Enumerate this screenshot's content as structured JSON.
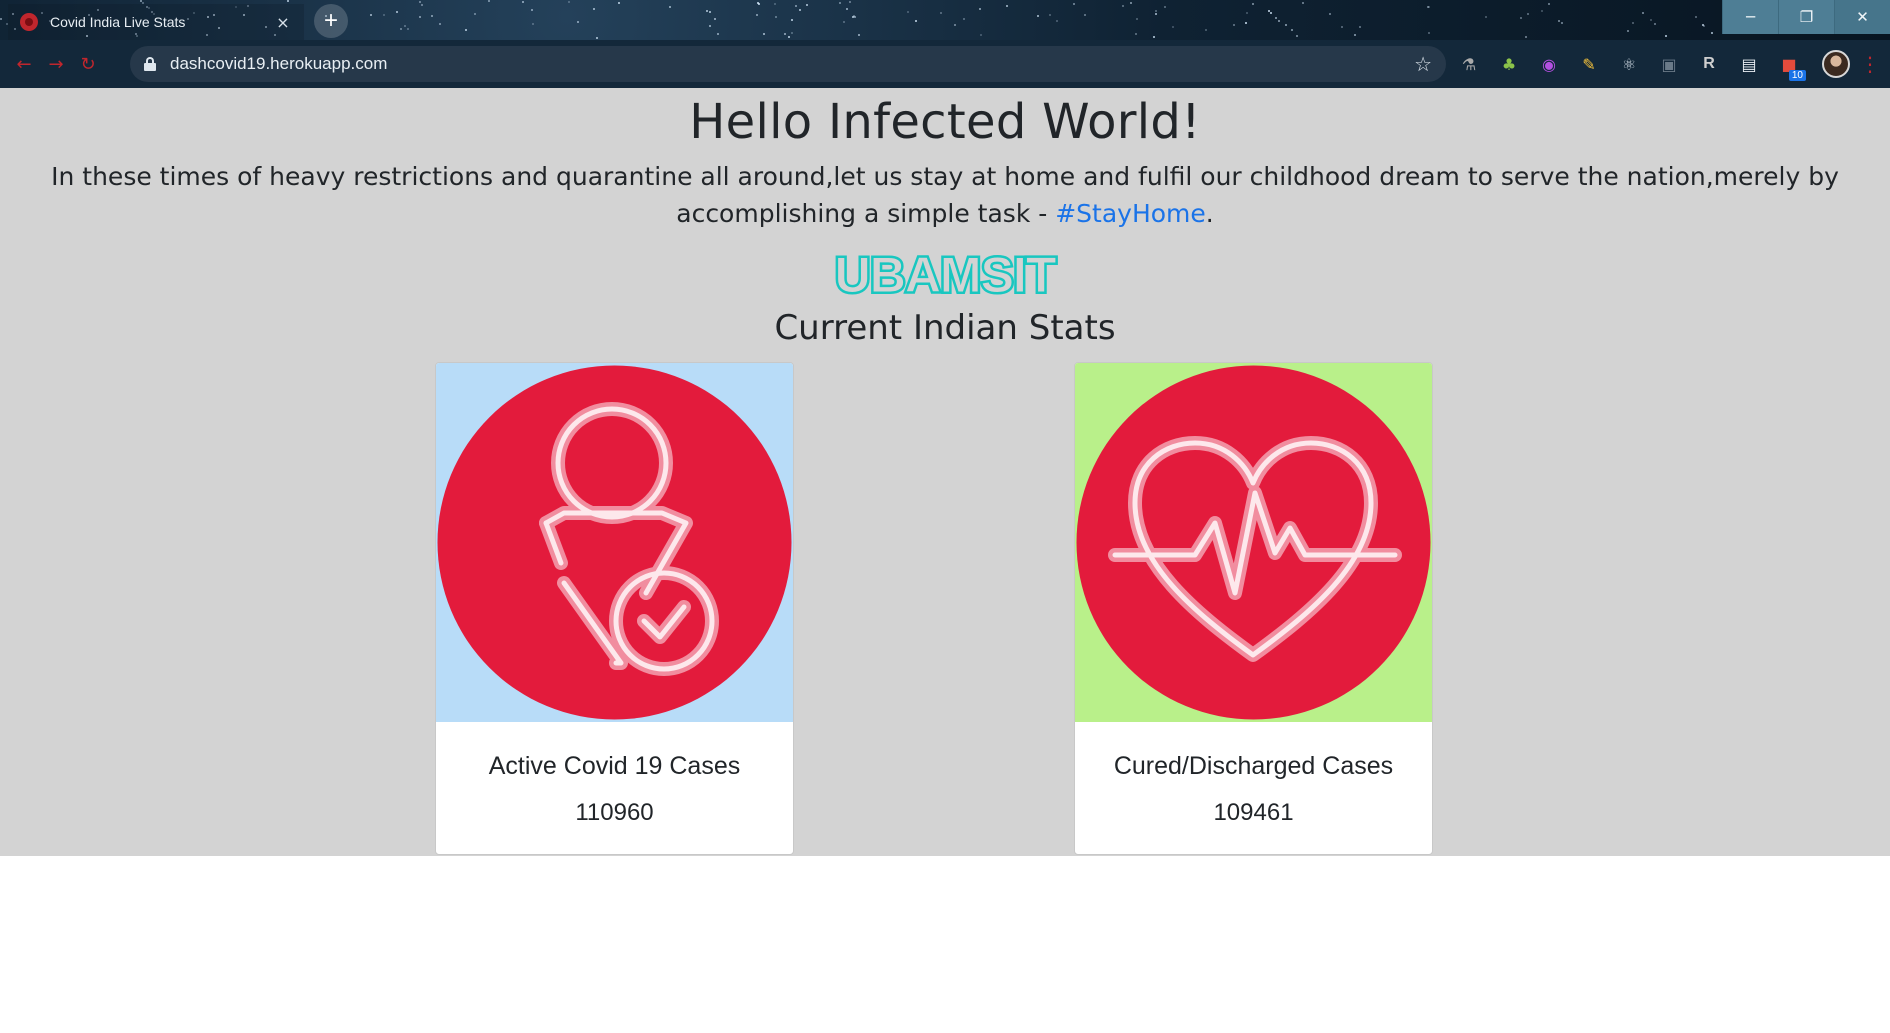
{
  "browser": {
    "tab_title": "Covid India Live Stats",
    "tab_close": "×",
    "new_tab": "+",
    "url": "dashcovid19.herokuapp.com",
    "window_controls": {
      "minimize": "─",
      "restore": "❐",
      "close": "✕"
    },
    "extensions": [
      {
        "name": "tool-icon",
        "glyph": "⚗"
      },
      {
        "name": "tree-icon",
        "glyph": "♣"
      },
      {
        "name": "purple-extension-icon",
        "glyph": "◉"
      },
      {
        "name": "pencil-icon",
        "glyph": "✎"
      },
      {
        "name": "react-icon",
        "glyph": "⚛"
      },
      {
        "name": "screen-icon",
        "glyph": "▣"
      },
      {
        "name": "r-extension-icon",
        "glyph": "R"
      },
      {
        "name": "stack-icon",
        "glyph": "▤"
      }
    ],
    "badge_count": "10"
  },
  "page": {
    "heading": "Hello Infected World!",
    "intro_text": "In these times of heavy restrictions and quarantine all around,let us stay at home and fulfil our childhood dream to serve the nation,merely by accomplishing a simple task - ",
    "hashtag": "#StayHome",
    "intro_end": ".",
    "logo_text": "UBAMSIT",
    "stats_title": "Current Indian Stats"
  },
  "cards": [
    {
      "title": "Active Covid 19 Cases",
      "value": "110960",
      "bg_color": "#b8dcf8",
      "icon": "person-check-icon"
    },
    {
      "title": "Cured/Discharged Cases",
      "value": "109461",
      "bg_color": "#b9f08a",
      "icon": "heartbeat-icon"
    }
  ],
  "colors": {
    "page_bg": "#d3d3d3",
    "icon_red": "#e31b3c",
    "logo_teal": "#19c7c0",
    "link_blue": "#1a73e8"
  }
}
